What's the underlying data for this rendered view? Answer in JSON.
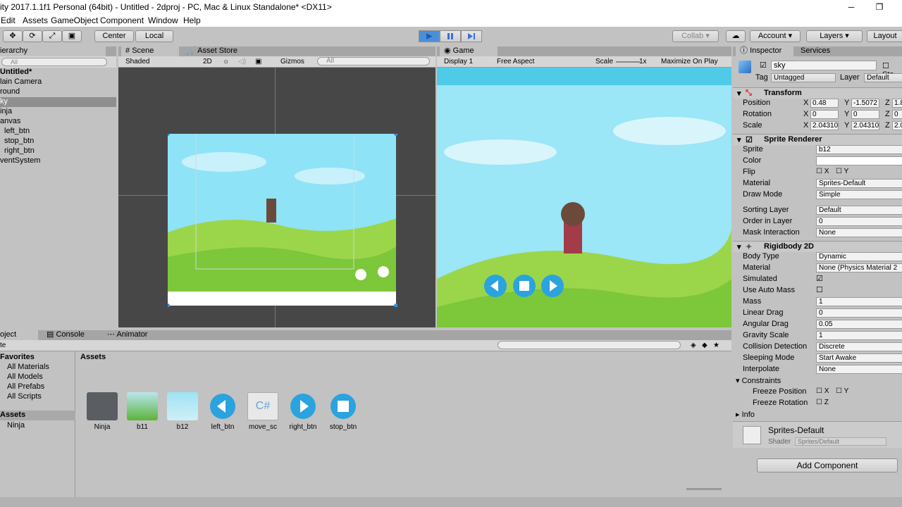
{
  "titlebar": {
    "title": "ity 2017.1.1f1 Personal (64bit) - Untitled - 2dproj - PC, Mac & Linux Standalone* <DX11>",
    "minimize": "─",
    "maximize": "❐"
  },
  "menu": [
    "Edit",
    "Assets",
    "GameObject",
    "Component",
    "Window",
    "Help"
  ],
  "toolbar": {
    "center": "Center",
    "local": "Local",
    "collab": "Collab",
    "account": "Account",
    "layers": "Layers",
    "layout": "Layout"
  },
  "hierarchy": {
    "tab": "ierarchy",
    "search_placeholder": "All",
    "scene": "Untitled*",
    "items": [
      "lain Camera",
      "round",
      "ky",
      "inja",
      "anvas",
      "left_btn",
      "stop_btn",
      "right_btn",
      "ventSystem"
    ]
  },
  "scene_view": {
    "tab_scene": "Scene",
    "tab_store": "Asset Store",
    "shading": "Shaded",
    "mode2d": "2D",
    "gizmos": "Gizmos",
    "search_placeholder": "All"
  },
  "game_view": {
    "tab": "Game",
    "display": "Display 1",
    "aspect": "Free Aspect",
    "scale_label": "Scale",
    "scale_value": "1x",
    "maximize": "Maximize On Play"
  },
  "inspector": {
    "tab": "Inspector",
    "tab_services": "Services",
    "object_name": "sky",
    "static": "Sta",
    "tag_label": "Tag",
    "tag": "Untagged",
    "layer_label": "Layer",
    "layer": "Default",
    "transform": {
      "title": "Transform",
      "position": "Position",
      "rotation": "Rotation",
      "scale": "Scale",
      "pos_x": "0.48",
      "pos_y": "-1.5072",
      "pos_z": "1.8",
      "rot_x": "0",
      "rot_y": "0",
      "rot_z": "0",
      "scl_x": "2.04310",
      "scl_y": "2.04310",
      "scl_z": "2.0",
      "x": "X",
      "y": "Y",
      "z": "Z"
    },
    "sprite_renderer": {
      "title": "Sprite Renderer",
      "sprite_label": "Sprite",
      "sprite": "b12",
      "color_label": "Color",
      "flip_label": "Flip",
      "material_label": "Material",
      "material": "Sprites-Default",
      "draw_mode_label": "Draw Mode",
      "draw_mode": "Simple",
      "sorting_label": "Sorting Layer",
      "sorting": "Default",
      "order_label": "Order in Layer",
      "order": "0",
      "mask_label": "Mask Interaction",
      "mask": "None"
    },
    "rigidbody": {
      "title": "Rigidbody 2D",
      "body_type_label": "Body Type",
      "body_type": "Dynamic",
      "material_label": "Material",
      "material": "None (Physics Material 2",
      "simulated_label": "Simulated",
      "auto_mass_label": "Use Auto Mass",
      "mass_label": "Mass",
      "mass": "1",
      "ldrag_label": "Linear Drag",
      "ldrag": "0",
      "adrag_label": "Angular Drag",
      "adrag": "0.05",
      "gravity_label": "Gravity Scale",
      "gravity": "1",
      "collision_label": "Collision Detection",
      "collision": "Discrete",
      "sleep_label": "Sleeping Mode",
      "sleep": "Start Awake",
      "interp_label": "Interpolate",
      "interp": "None",
      "constraints_label": "Constraints",
      "freeze_pos_label": "Freeze Position",
      "freeze_rot_label": "Freeze Rotation",
      "info_label": "Info"
    },
    "material_preview": {
      "name": "Sprites-Default",
      "shader_label": "Shader",
      "shader": "Sprites/Default"
    },
    "add_component": "Add Component"
  },
  "project": {
    "tab_project": "oject",
    "tab_console": "Console",
    "tab_animator": "Animator",
    "create": "te",
    "favorites_label": "Favorites",
    "favorites": [
      "All Materials",
      "All Models",
      "All Prefabs",
      "All Scripts"
    ],
    "assets_root": "Assets",
    "assets_child": "Ninja",
    "assets_header": "Assets",
    "assets": [
      {
        "name": "Ninja",
        "kind": "folder"
      },
      {
        "name": "b11",
        "kind": "sprite-grass"
      },
      {
        "name": "b12",
        "kind": "sprite-sky"
      },
      {
        "name": "left_btn",
        "kind": "btn-left"
      },
      {
        "name": "move_sc",
        "kind": "script"
      },
      {
        "name": "right_btn",
        "kind": "btn-right"
      },
      {
        "name": "stop_btn",
        "kind": "btn-stop"
      }
    ]
  },
  "colors": {
    "accent_blue": "#3a8fd6",
    "selected_row": "#8f8f8f",
    "scene_bg": "#474747",
    "game_sky": "#7fd9f2",
    "grass": "#8ad13a"
  }
}
